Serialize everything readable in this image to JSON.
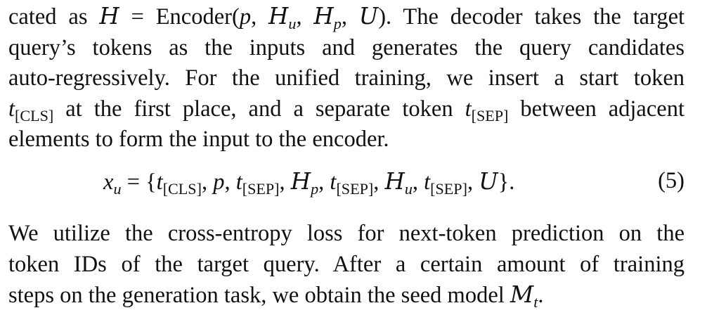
{
  "paragraph1": {
    "line1": {
      "pre": "cated as ",
      "H": "H",
      "eq": " = ",
      "fn": "Encoder",
      "open": "(",
      "p": "p",
      "c1": ", ",
      "Hu": "H",
      "u": "u",
      "c2": ", ",
      "Hp": "H",
      "ps": "p",
      "c3": ", ",
      "U": "U",
      "close": ")",
      "post": ". The decoder takes the target"
    },
    "line2": "query’s tokens as the inputs and generates the query candidates",
    "line3": "auto-regressively. For the unified training, we insert a start token",
    "line4": {
      "t1": "t",
      "cls": "[CLS]",
      "mid": " at the first place, and a separate token ",
      "t2": "t",
      "sep": "[SEP]",
      "post": " between adjacent"
    },
    "line5": "elements to form the input to the encoder."
  },
  "equation": {
    "lhs": "x",
    "lhs_sub": "u",
    "eq": " = {",
    "t": "t",
    "cls": "[CLS]",
    "sep": "[SEP]",
    "comma": ", ",
    "p": "p",
    "H": "H",
    "p_sub": "p",
    "u_sub": "u",
    "U": "U",
    "end": "}.",
    "number": "(5)"
  },
  "paragraph2": {
    "line1": "We utilize the cross-entropy loss for next-token prediction on the",
    "line2": "token IDs of the target query. After a certain amount of training",
    "line3_pre": "steps on the generation task, we obtain the seed model ",
    "M": "M",
    "M_sub": "t",
    "line3_post": "."
  }
}
